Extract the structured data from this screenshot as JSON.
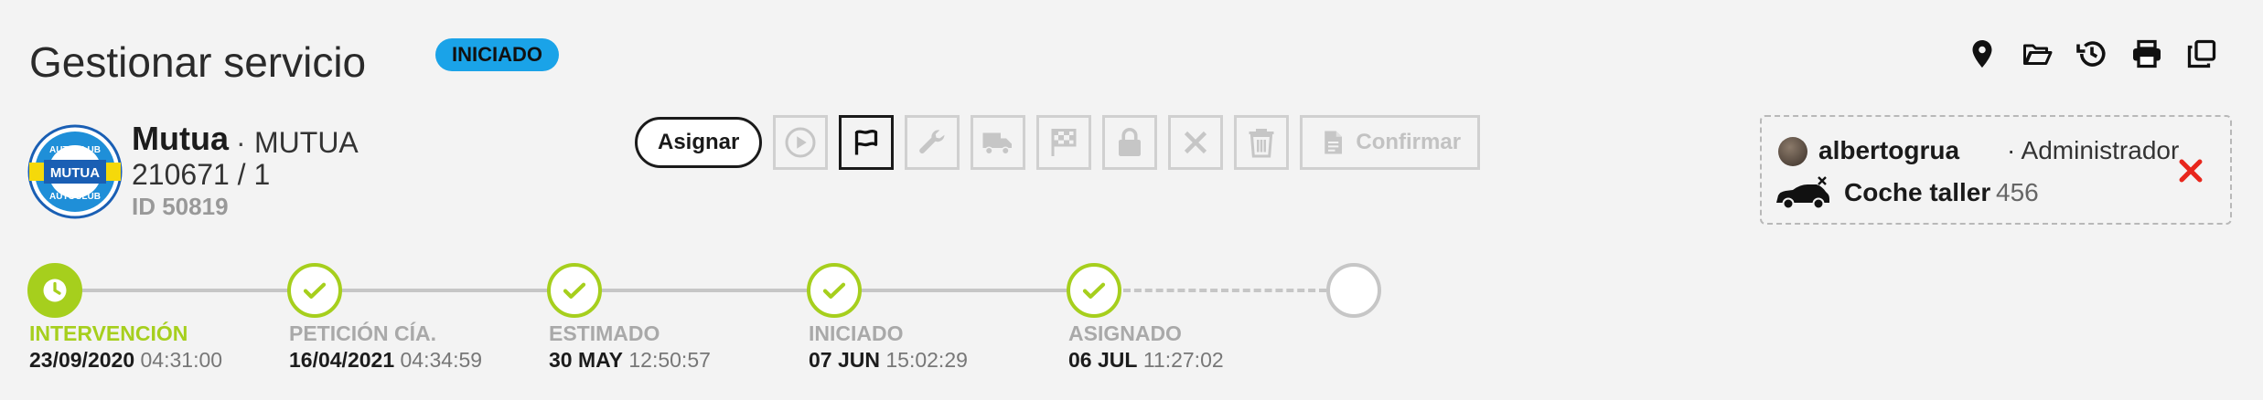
{
  "header": {
    "title": "Gestionar servicio",
    "status": "INICIADO"
  },
  "top_icons": [
    "location-icon",
    "folder-open-icon",
    "history-icon",
    "print-icon",
    "copy-icon"
  ],
  "client": {
    "name": "Mutua",
    "separator": "·",
    "code": "MUTUA",
    "ref": "210671 / 1",
    "id": "ID 50819",
    "logo": {
      "top_text": "AUTOCLUB",
      "middle_text": "MUTUA",
      "bottom_text": "AUTOCLUB"
    }
  },
  "actions": {
    "assign_label": "Asignar",
    "confirm_label": "Confirmar"
  },
  "user_panel": {
    "username": "albertogrua",
    "role": "· Administrador",
    "vehicle_name": "Coche taller",
    "vehicle_number": "456"
  },
  "timeline": {
    "steps": [
      {
        "label": "INTERVENCIÓN",
        "date": "23/09/2020",
        "time": "04:31:00",
        "state": "current"
      },
      {
        "label": "PETICIÓN CÍA.",
        "date": "16/04/2021",
        "time": "04:34:59",
        "state": "done"
      },
      {
        "label": "ESTIMADO",
        "date": "30 MAY",
        "time": "12:50:57",
        "state": "done"
      },
      {
        "label": "INICIADO",
        "date": "07 JUN",
        "time": "15:02:29",
        "state": "done"
      },
      {
        "label": "ASIGNADO",
        "date": "06 JUL",
        "time": "11:27:02",
        "state": "done"
      }
    ]
  },
  "colors": {
    "accent_green": "#a6cf1d",
    "badge_blue": "#1aa3e8",
    "remove_red": "#e8261c",
    "disabled_gray": "#c6c6c6"
  }
}
